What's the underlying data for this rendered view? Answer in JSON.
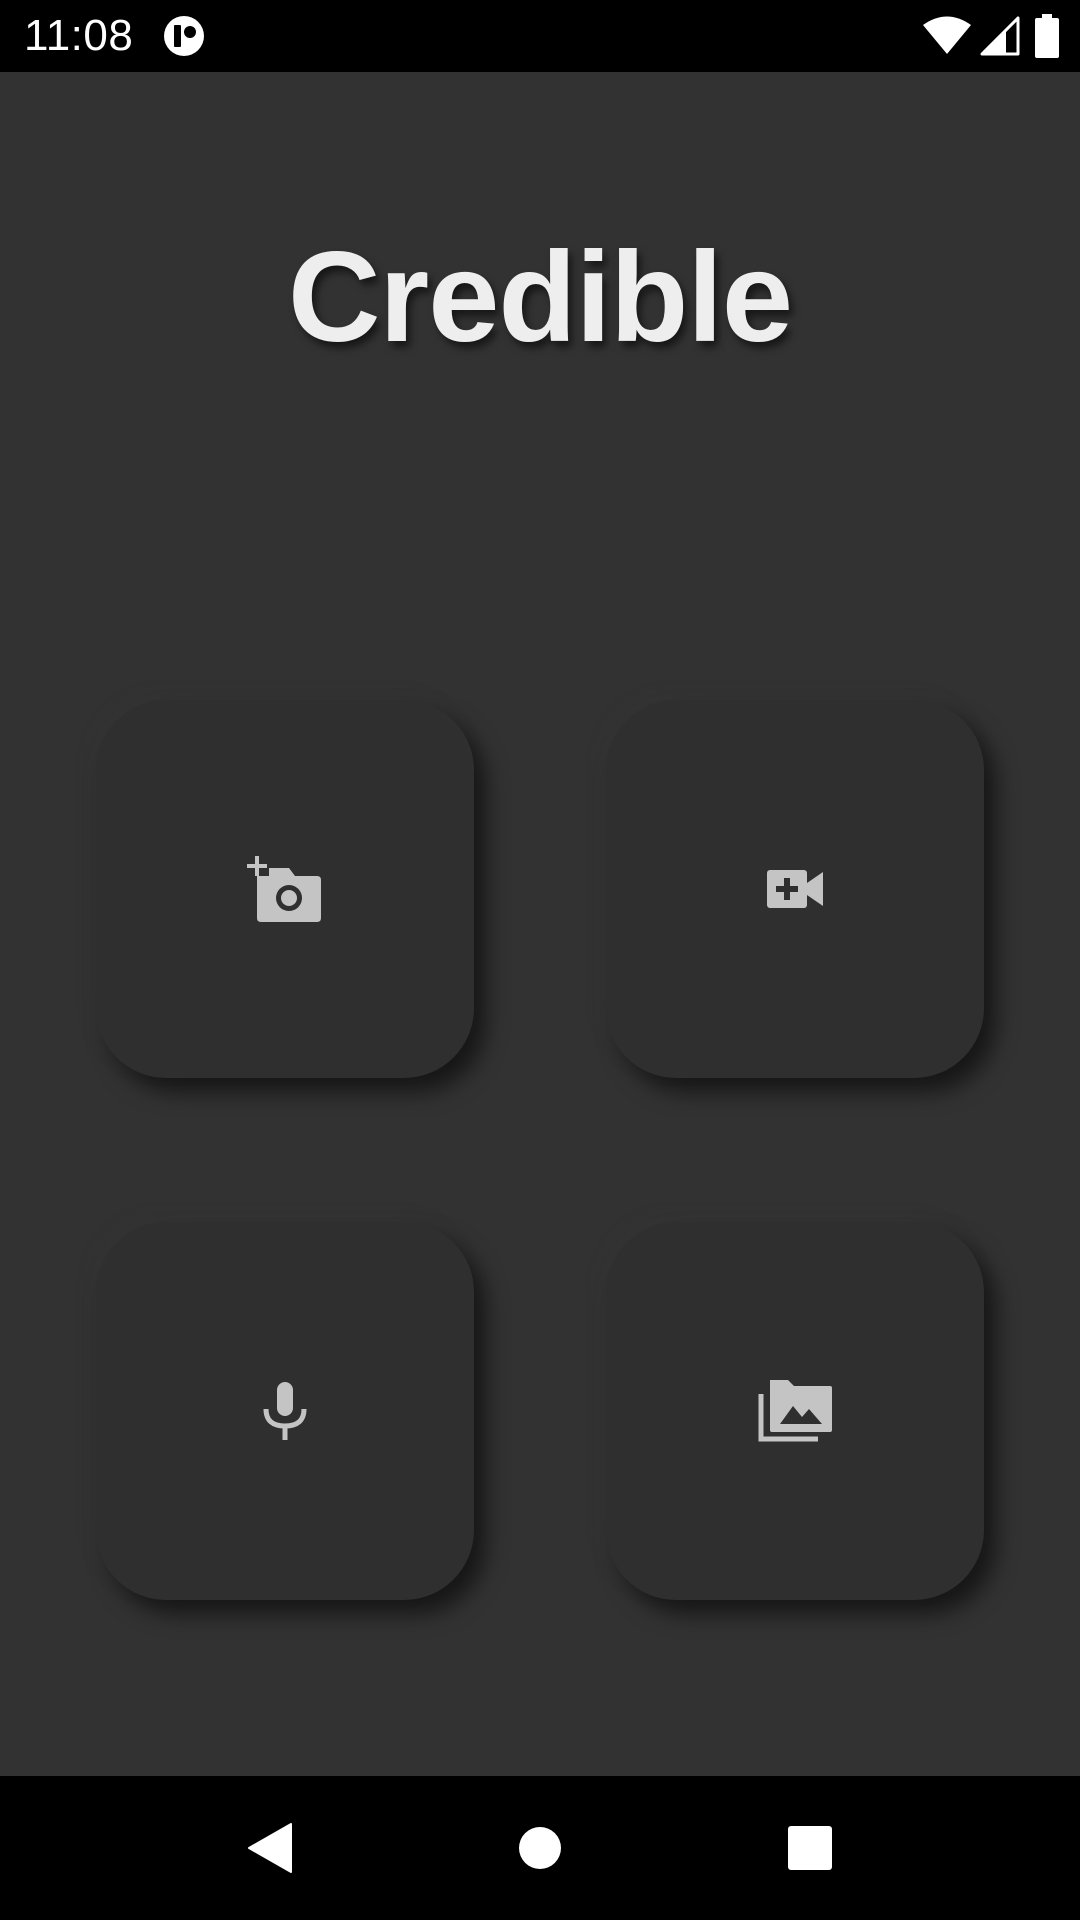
{
  "status_bar": {
    "time": "11:08",
    "icons": [
      "app-notification-icon",
      "wifi-icon",
      "cell-signal-icon",
      "battery-icon"
    ]
  },
  "app": {
    "title": "Credible"
  },
  "actions": [
    {
      "id": "photo",
      "icon": "add-a-photo-icon"
    },
    {
      "id": "video",
      "icon": "video-call-icon"
    },
    {
      "id": "audio",
      "icon": "microphone-icon"
    },
    {
      "id": "gallery",
      "icon": "photo-library-icon"
    }
  ],
  "nav_bar": {
    "buttons": [
      "back-icon",
      "home-icon",
      "recents-icon"
    ]
  },
  "colors": {
    "background": "#323232",
    "tile": "#2f2f2f",
    "title": "#eeeeee",
    "icon": "#c4c4c4",
    "bars": "#000000"
  }
}
